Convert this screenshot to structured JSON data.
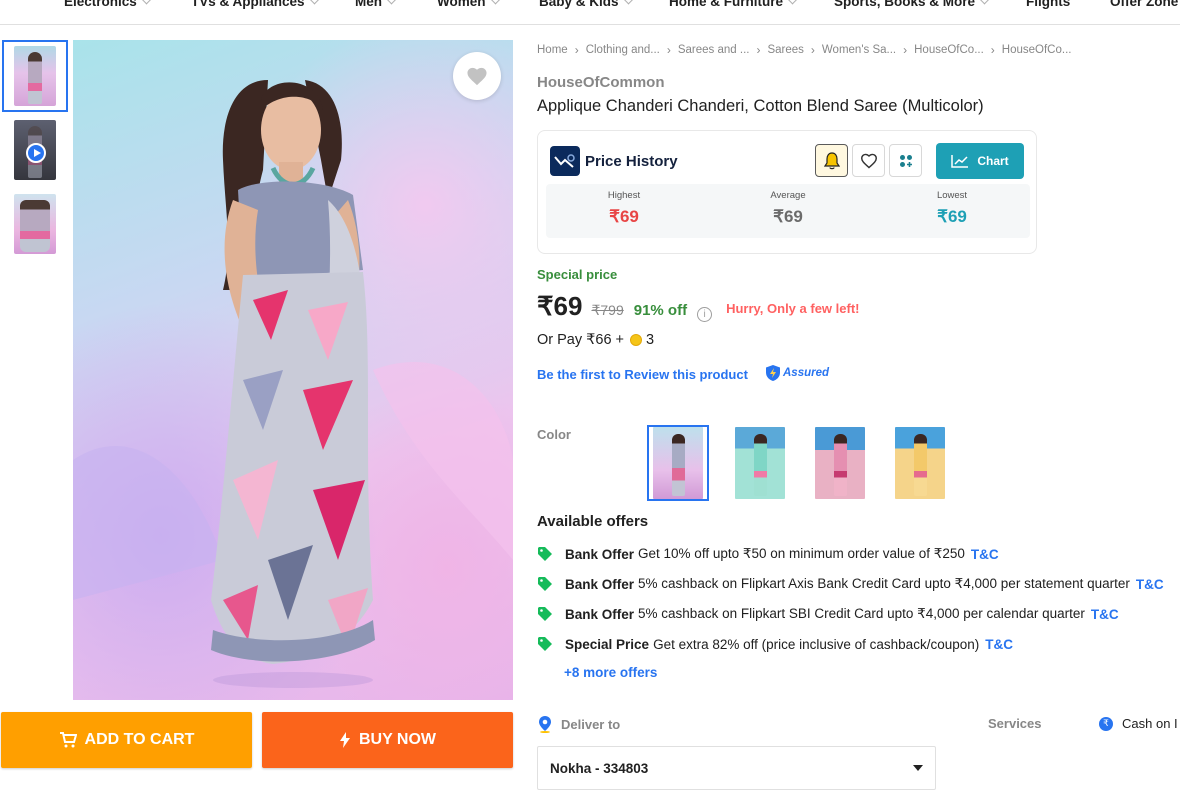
{
  "nav": {
    "items": [
      {
        "label": "Electronics",
        "dropdown": true
      },
      {
        "label": "TVs & Appliances",
        "dropdown": true
      },
      {
        "label": "Men",
        "dropdown": true
      },
      {
        "label": "Women",
        "dropdown": true
      },
      {
        "label": "Baby & Kids",
        "dropdown": true
      },
      {
        "label": "Home & Furniture",
        "dropdown": true
      },
      {
        "label": "Sports, Books & More",
        "dropdown": true
      },
      {
        "label": "Flights",
        "dropdown": false
      },
      {
        "label": "Offer Zone",
        "dropdown": false
      }
    ]
  },
  "gallery": {
    "thumbnails": [
      "image-1",
      "video-1",
      "image-2"
    ],
    "active_index": 0
  },
  "actions": {
    "add_to_cart": "ADD TO CART",
    "buy_now": "BUY NOW"
  },
  "breadcrumb": [
    "Home",
    "Clothing and...",
    "Sarees and ...",
    "Sarees",
    "Women's Sa...",
    "HouseOfCo...",
    "HouseOfCo..."
  ],
  "product": {
    "brand": "HouseOfCommon",
    "title": "Applique Chanderi Chanderi, Cotton Blend Saree  (Multicolor)"
  },
  "price_history": {
    "title": "Price History",
    "chart_button": "Chart",
    "highest_label": "Highest",
    "highest_value": "₹69",
    "average_label": "Average",
    "average_value": "₹69",
    "lowest_label": "Lowest",
    "lowest_value": "₹69",
    "colors": {
      "highest": "#e84545",
      "average": "#6b6b6b",
      "lowest": "#1ea0b5"
    }
  },
  "pricing": {
    "special_label": "Special price",
    "price": "₹69",
    "mrp": "₹799",
    "discount": "91% off",
    "info": "i",
    "hurry": "Hurry, Only a few left!",
    "or_pay_prefix": "Or Pay ₹66 +",
    "or_pay_coins": "3"
  },
  "review_link": "Be the first to Review this product",
  "assured_label": "Assured",
  "colors_section": {
    "label": "Color",
    "options": [
      "multicolor-grey",
      "mint-floral",
      "pink-floral",
      "yellow-floral"
    ],
    "selected_index": 0
  },
  "offers": {
    "title": "Available offers",
    "items": [
      {
        "type": "Bank Offer",
        "text": "Get 10% off upto ₹50 on minimum order value of ₹250",
        "link": "T&C"
      },
      {
        "type": "Bank Offer",
        "text": "5% cashback on Flipkart Axis Bank Credit Card upto ₹4,000 per statement quarter",
        "link": "T&C"
      },
      {
        "type": "Bank Offer",
        "text": "5% cashback on Flipkart SBI Credit Card upto ₹4,000 per calendar quarter",
        "link": "T&C"
      },
      {
        "type": "Special Price",
        "text": "Get extra 82% off (price inclusive of cashback/coupon)",
        "link": "T&C"
      }
    ],
    "more": "+8 more offers"
  },
  "delivery": {
    "label": "Deliver to",
    "pincode": "Nokha - 334803",
    "services_label": "Services",
    "service_1": "Cash on I"
  },
  "theme": {
    "brand_blue": "#2874f0",
    "cart_orange": "#ff9f00",
    "buy_orange": "#fb641b",
    "green": "#388e3c"
  }
}
